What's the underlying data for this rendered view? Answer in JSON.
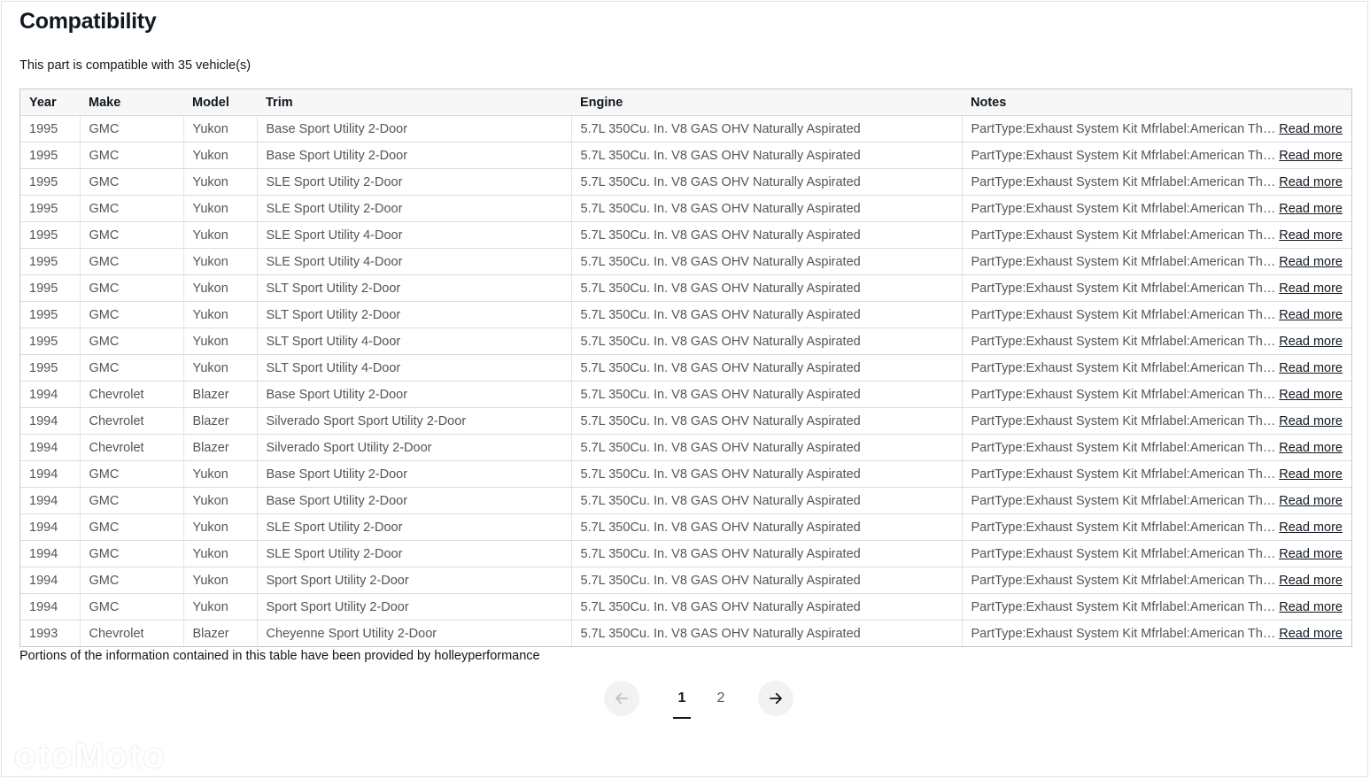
{
  "title": "Compatibility",
  "summary": "This part is compatible with 35 vehicle(s)",
  "columns": [
    "Year",
    "Make",
    "Model",
    "Trim",
    "Engine",
    "Notes"
  ],
  "rows": [
    {
      "year": "1995",
      "make": "GMC",
      "model": "Yukon",
      "trim": "Base Sport Utility 2-Door",
      "engine": "5.7L 350Cu. In. V8 GAS OHV Naturally Aspirated",
      "notes": "PartType:Exhaust System Kit Mfrlabel:American Thund..."
    },
    {
      "year": "1995",
      "make": "GMC",
      "model": "Yukon",
      "trim": "Base Sport Utility 2-Door",
      "engine": "5.7L 350Cu. In. V8 GAS OHV Naturally Aspirated",
      "notes": "PartType:Exhaust System Kit Mfrlabel:American Thund..."
    },
    {
      "year": "1995",
      "make": "GMC",
      "model": "Yukon",
      "trim": "SLE Sport Utility 2-Door",
      "engine": "5.7L 350Cu. In. V8 GAS OHV Naturally Aspirated",
      "notes": "PartType:Exhaust System Kit Mfrlabel:American Thund..."
    },
    {
      "year": "1995",
      "make": "GMC",
      "model": "Yukon",
      "trim": "SLE Sport Utility 2-Door",
      "engine": "5.7L 350Cu. In. V8 GAS OHV Naturally Aspirated",
      "notes": "PartType:Exhaust System Kit Mfrlabel:American Thund..."
    },
    {
      "year": "1995",
      "make": "GMC",
      "model": "Yukon",
      "trim": "SLE Sport Utility 4-Door",
      "engine": "5.7L 350Cu. In. V8 GAS OHV Naturally Aspirated",
      "notes": "PartType:Exhaust System Kit Mfrlabel:American Thund..."
    },
    {
      "year": "1995",
      "make": "GMC",
      "model": "Yukon",
      "trim": "SLE Sport Utility 4-Door",
      "engine": "5.7L 350Cu. In. V8 GAS OHV Naturally Aspirated",
      "notes": "PartType:Exhaust System Kit Mfrlabel:American Thund..."
    },
    {
      "year": "1995",
      "make": "GMC",
      "model": "Yukon",
      "trim": "SLT Sport Utility 2-Door",
      "engine": "5.7L 350Cu. In. V8 GAS OHV Naturally Aspirated",
      "notes": "PartType:Exhaust System Kit Mfrlabel:American Thund..."
    },
    {
      "year": "1995",
      "make": "GMC",
      "model": "Yukon",
      "trim": "SLT Sport Utility 2-Door",
      "engine": "5.7L 350Cu. In. V8 GAS OHV Naturally Aspirated",
      "notes": "PartType:Exhaust System Kit Mfrlabel:American Thund..."
    },
    {
      "year": "1995",
      "make": "GMC",
      "model": "Yukon",
      "trim": "SLT Sport Utility 4-Door",
      "engine": "5.7L 350Cu. In. V8 GAS OHV Naturally Aspirated",
      "notes": "PartType:Exhaust System Kit Mfrlabel:American Thund..."
    },
    {
      "year": "1995",
      "make": "GMC",
      "model": "Yukon",
      "trim": "SLT Sport Utility 4-Door",
      "engine": "5.7L 350Cu. In. V8 GAS OHV Naturally Aspirated",
      "notes": "PartType:Exhaust System Kit Mfrlabel:American Thund..."
    },
    {
      "year": "1994",
      "make": "Chevrolet",
      "model": "Blazer",
      "trim": "Base Sport Utility 2-Door",
      "engine": "5.7L 350Cu. In. V8 GAS OHV Naturally Aspirated",
      "notes": "PartType:Exhaust System Kit Mfrlabel:American Thund..."
    },
    {
      "year": "1994",
      "make": "Chevrolet",
      "model": "Blazer",
      "trim": "Silverado Sport Sport Utility 2-Door",
      "engine": "5.7L 350Cu. In. V8 GAS OHV Naturally Aspirated",
      "notes": "PartType:Exhaust System Kit Mfrlabel:American Thund..."
    },
    {
      "year": "1994",
      "make": "Chevrolet",
      "model": "Blazer",
      "trim": "Silverado Sport Utility 2-Door",
      "engine": "5.7L 350Cu. In. V8 GAS OHV Naturally Aspirated",
      "notes": "PartType:Exhaust System Kit Mfrlabel:American Thund..."
    },
    {
      "year": "1994",
      "make": "GMC",
      "model": "Yukon",
      "trim": "Base Sport Utility 2-Door",
      "engine": "5.7L 350Cu. In. V8 GAS OHV Naturally Aspirated",
      "notes": "PartType:Exhaust System Kit Mfrlabel:American Thund..."
    },
    {
      "year": "1994",
      "make": "GMC",
      "model": "Yukon",
      "trim": "Base Sport Utility 2-Door",
      "engine": "5.7L 350Cu. In. V8 GAS OHV Naturally Aspirated",
      "notes": "PartType:Exhaust System Kit Mfrlabel:American Thund..."
    },
    {
      "year": "1994",
      "make": "GMC",
      "model": "Yukon",
      "trim": "SLE Sport Utility 2-Door",
      "engine": "5.7L 350Cu. In. V8 GAS OHV Naturally Aspirated",
      "notes": "PartType:Exhaust System Kit Mfrlabel:American Thund..."
    },
    {
      "year": "1994",
      "make": "GMC",
      "model": "Yukon",
      "trim": "SLE Sport Utility 2-Door",
      "engine": "5.7L 350Cu. In. V8 GAS OHV Naturally Aspirated",
      "notes": "PartType:Exhaust System Kit Mfrlabel:American Thund..."
    },
    {
      "year": "1994",
      "make": "GMC",
      "model": "Yukon",
      "trim": "Sport Sport Utility 2-Door",
      "engine": "5.7L 350Cu. In. V8 GAS OHV Naturally Aspirated",
      "notes": "PartType:Exhaust System Kit Mfrlabel:American Thund..."
    },
    {
      "year": "1994",
      "make": "GMC",
      "model": "Yukon",
      "trim": "Sport Sport Utility 2-Door",
      "engine": "5.7L 350Cu. In. V8 GAS OHV Naturally Aspirated",
      "notes": "PartType:Exhaust System Kit Mfrlabel:American Thund..."
    },
    {
      "year": "1993",
      "make": "Chevrolet",
      "model": "Blazer",
      "trim": "Cheyenne Sport Utility 2-Door",
      "engine": "5.7L 350Cu. In. V8 GAS OHV Naturally Aspirated",
      "notes": "PartType:Exhaust System Kit Mfrlabel:American Thund..."
    }
  ],
  "read_more_label": "Read more",
  "source_note": "Portions of the information contained in this table have been provided by holleyperformance",
  "pagination": {
    "prev_icon": "arrow-left-icon",
    "next_icon": "arrow-right-icon",
    "pages": [
      "1",
      "2"
    ],
    "current": "1"
  },
  "watermark": "otoMoto",
  "colors": {
    "text": "#111820",
    "muted": "#555555",
    "header_bg": "#f7f7f7",
    "border": "#c7c7c7"
  }
}
